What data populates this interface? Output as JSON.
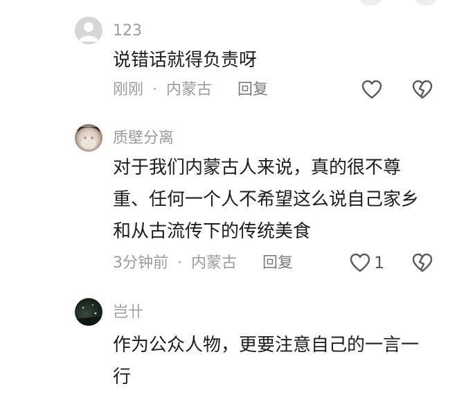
{
  "comments": [
    {
      "username": "123",
      "text_lines": [
        "说错话就得负责呀"
      ],
      "time": "刚刚",
      "location": "内蒙古",
      "reply_label": "回复",
      "likes": ""
    },
    {
      "username": "质壁分离",
      "text_lines": [
        "对于我们内蒙古人来说，真的很不尊",
        "重、任何一个人不希望这么说自己家乡",
        "和从古流传下的传统美食"
      ],
      "time": "3分钟前",
      "location": "内蒙古",
      "reply_label": "回复",
      "likes": "1"
    },
    {
      "username": "岂卄",
      "text_lines": [
        "作为公众人物，更要注意自己的一言一",
        "行"
      ]
    }
  ],
  "separator": "·",
  "icons": {
    "like": "heart-outline-icon",
    "dislike": "broken-heart-icon",
    "default_avatar": "default-user-avatar-icon"
  },
  "colors": {
    "primary_text": "#1d1d1d",
    "secondary_text": "#9b9b9b",
    "icon": "#5a5a5a"
  }
}
